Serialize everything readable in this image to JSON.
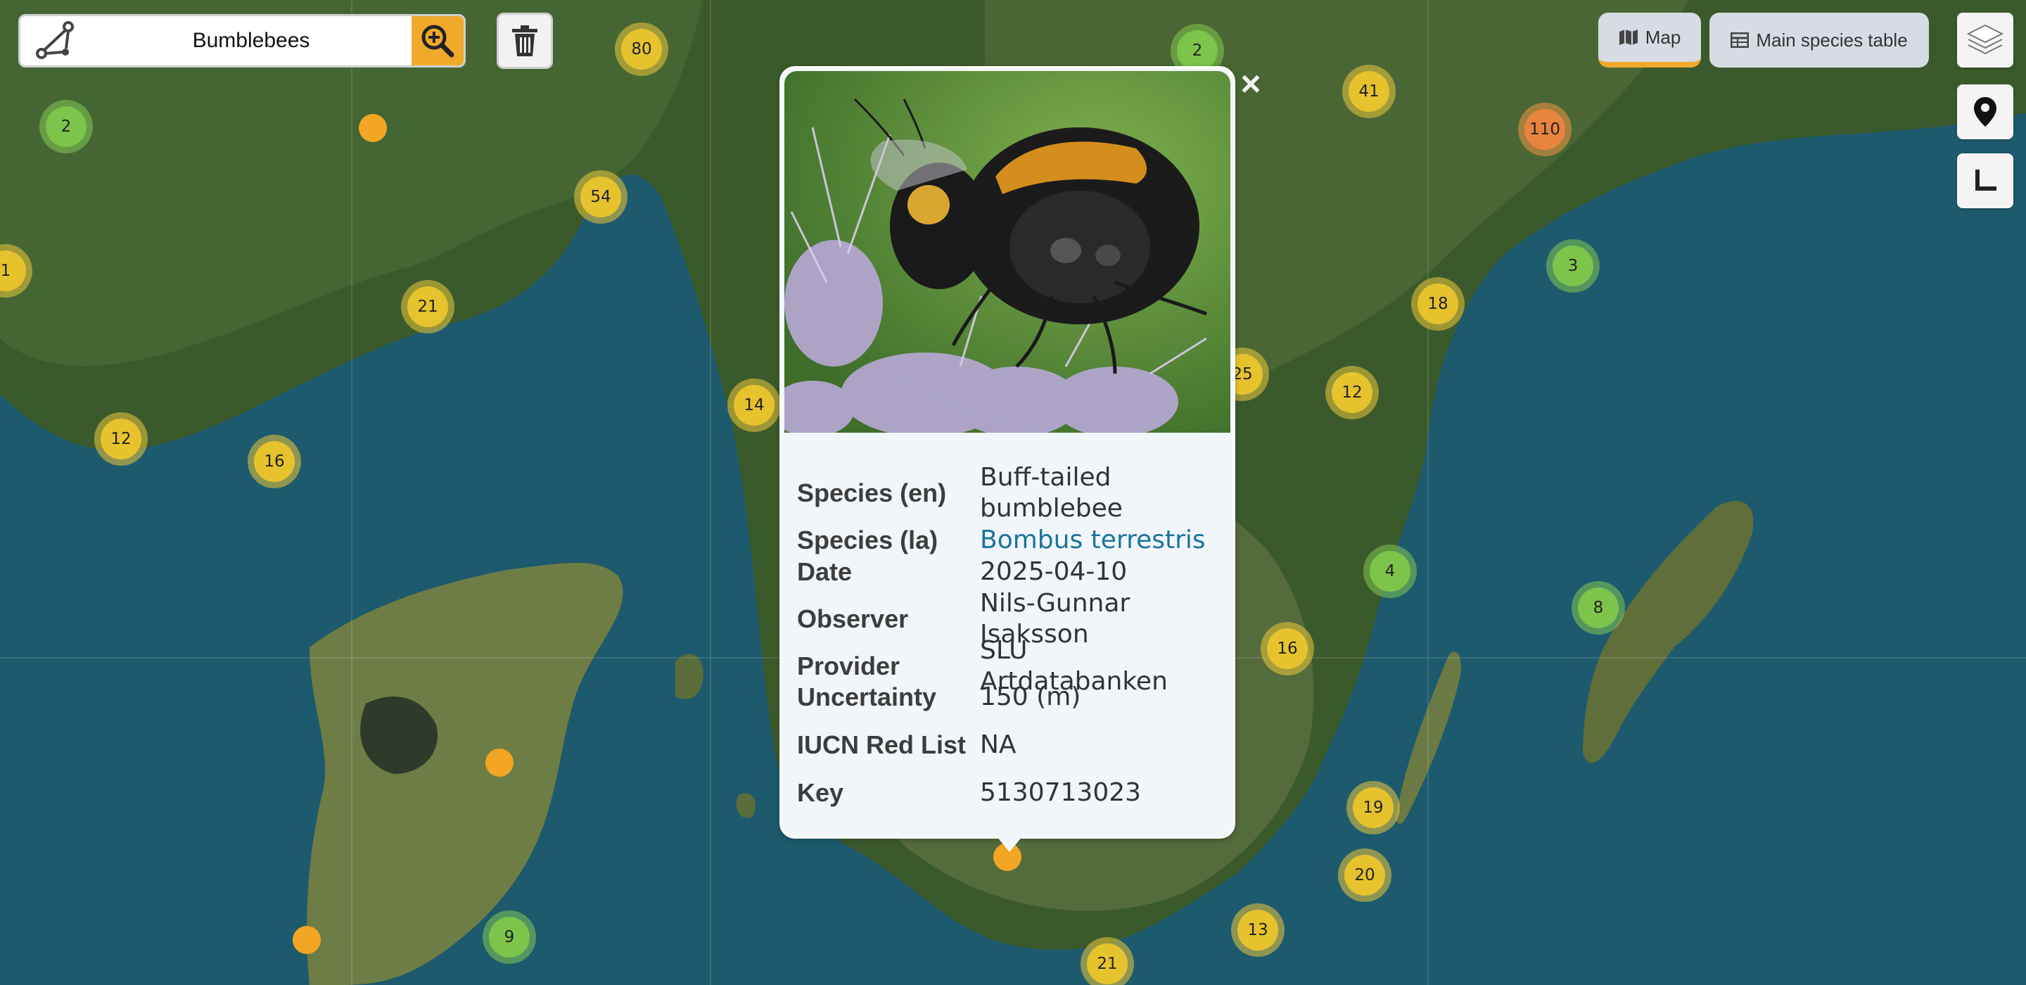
{
  "search": {
    "label": "Bumblebees"
  },
  "tabs": {
    "map": "Map",
    "table": "Main species table"
  },
  "clusters": [
    {
      "label": "2",
      "color": "green"
    },
    {
      "label": "80",
      "color": "yellow"
    },
    {
      "label": "2",
      "color": "green"
    },
    {
      "label": "41",
      "color": "yellow"
    },
    {
      "label": "110",
      "color": "orange"
    },
    {
      "label": "54",
      "color": "yellow"
    },
    {
      "label": "1",
      "color": "yellow"
    },
    {
      "label": "21",
      "color": "yellow"
    },
    {
      "label": "3",
      "color": "green"
    },
    {
      "label": "18",
      "color": "yellow"
    },
    {
      "label": "25",
      "color": "yellow"
    },
    {
      "label": "12",
      "color": "yellow"
    },
    {
      "label": "14",
      "color": "yellow"
    },
    {
      "label": "12",
      "color": "yellow"
    },
    {
      "label": "16",
      "color": "yellow"
    },
    {
      "label": "4",
      "color": "green"
    },
    {
      "label": "8",
      "color": "green"
    },
    {
      "label": "16",
      "color": "yellow"
    },
    {
      "label": "19",
      "color": "yellow"
    },
    {
      "label": "20",
      "color": "yellow"
    },
    {
      "label": "13",
      "color": "yellow"
    },
    {
      "label": "21",
      "color": "yellow"
    },
    {
      "label": "9",
      "color": "green"
    }
  ],
  "popup": {
    "rows": [
      {
        "key": "Species (en)",
        "value": "Buff-tailed bumblebee"
      },
      {
        "key": "Species (la)",
        "value": "Bombus terrestris",
        "link": true
      },
      {
        "key": "Date",
        "value": "2025-04-10"
      },
      {
        "key": "Observer",
        "value": "Nils-Gunnar Isaksson"
      },
      {
        "key": "Provider",
        "value": "SLU Artdatabanken"
      },
      {
        "key": "Uncertainty",
        "value": "150 (m)"
      },
      {
        "key": "IUCN Red List",
        "value": "NA"
      },
      {
        "key": "Key",
        "value": "5130713023"
      }
    ]
  }
}
